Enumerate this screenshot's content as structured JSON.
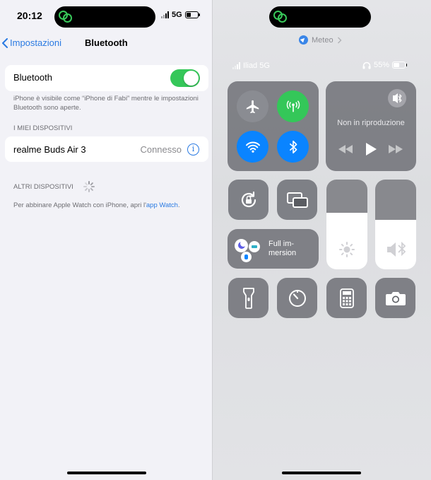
{
  "left": {
    "status": {
      "time": "20:12",
      "network": "5G"
    },
    "nav": {
      "back_label": "Impostazioni",
      "title": "Bluetooth"
    },
    "bluetooth_row": {
      "label": "Bluetooth",
      "enabled": true
    },
    "visibility_note": "iPhone è visibile come “iPhone di Fabi” mentre le impostazioni Bluetooth sono aperte.",
    "my_devices": {
      "header": "I MIEI DISPOSITIVI",
      "devices": [
        {
          "name": "realme Buds Air 3",
          "status": "Connesso"
        }
      ]
    },
    "other_devices": {
      "header": "ALTRI DISPOSITIVI",
      "note_prefix": "Per abbinare Apple Watch con iPhone, apri l'",
      "note_link": "app Watch",
      "note_suffix": "."
    }
  },
  "right": {
    "banner": {
      "label": "Meteo"
    },
    "status": {
      "carrier": "Iliad 5G",
      "battery": "55%"
    },
    "connectivity": {
      "airplane": false,
      "cellular": true,
      "wifi": true,
      "bluetooth": true
    },
    "now_playing": {
      "title": "Non in riproduzione"
    },
    "focus": {
      "label_line1": "Full im-",
      "label_line2": "mersion"
    },
    "brightness_level": 0.63,
    "volume_level": 0.55
  },
  "colors": {
    "accent_blue": "#2a7ae2",
    "toggle_green": "#35c759",
    "cellular_green": "#34c759",
    "cc_blue": "#0a84ff"
  },
  "icons": [
    "chevron-left-icon",
    "info-icon",
    "airplane-icon",
    "antenna-icon",
    "wifi-icon",
    "bluetooth-icon",
    "airplay-icon",
    "rewind-icon",
    "play-icon",
    "fast-forward-icon",
    "rotation-lock-icon",
    "screen-mirroring-icon",
    "brightness-icon",
    "volume-icon",
    "flashlight-icon",
    "timer-icon",
    "calculator-icon",
    "camera-icon",
    "location-arrow-icon",
    "headphones-icon"
  ]
}
